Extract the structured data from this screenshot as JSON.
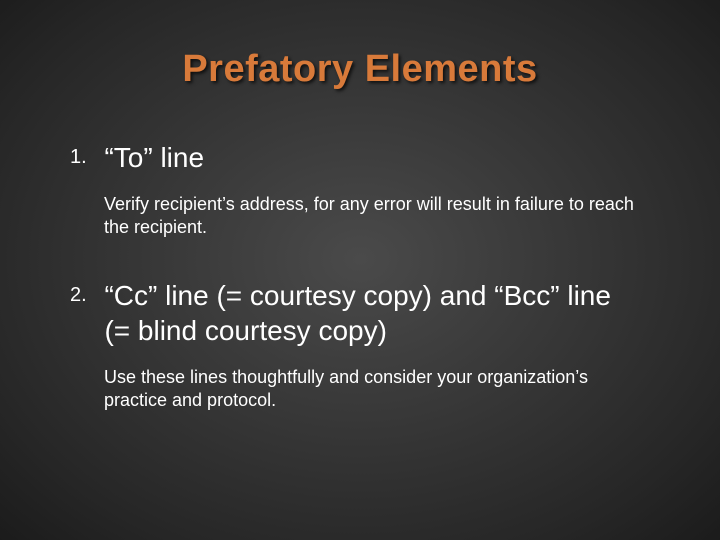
{
  "title": "Prefatory Elements",
  "items": [
    {
      "num": "1.",
      "heading": "“To” line",
      "desc": "Verify recipient’s address, for any error will result in failure to reach the recipient."
    },
    {
      "num": "2.",
      "heading": "“Cc”  line (= courtesy copy) and “Bcc” line (= blind courtesy copy)",
      "desc": "Use these lines thoughtfully and consider your organization’s practice and protocol."
    }
  ]
}
